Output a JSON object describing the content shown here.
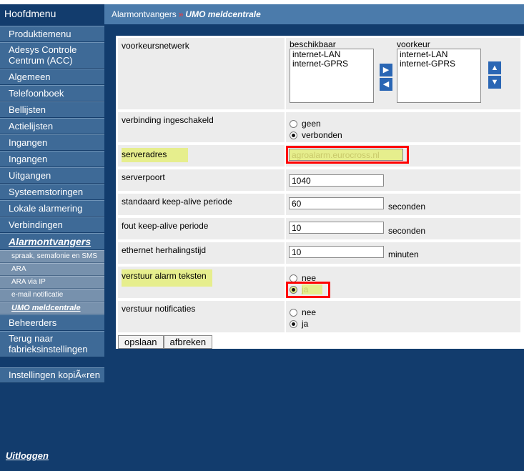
{
  "sidebar": {
    "header": "Hoofdmenu",
    "items": [
      {
        "label": "Produktiemenu"
      },
      {
        "label": "Adesys Controle Centrum (ACC)"
      },
      {
        "label": "Algemeen"
      },
      {
        "label": "Telefoonboek"
      },
      {
        "label": "Bellijsten"
      },
      {
        "label": "Actielijsten"
      },
      {
        "label": "Ingangen"
      },
      {
        "label": "Ingangen"
      },
      {
        "label": "Uitgangen"
      },
      {
        "label": "Systeemstoringen"
      },
      {
        "label": "Lokale alarmering"
      },
      {
        "label": "Verbindingen"
      },
      {
        "label": "Alarmontvangers"
      }
    ],
    "subitems": [
      {
        "label": "spraak, semafonie en SMS"
      },
      {
        "label": "ARA"
      },
      {
        "label": "ARA via IP"
      },
      {
        "label": "e-mail notificatie"
      },
      {
        "label": "UMO meldcentrale"
      }
    ],
    "bottom_items": [
      {
        "label": "Beheerders"
      },
      {
        "label": "Terug naar fabrieksinstellingen"
      },
      {
        "label": "Instellingen kopiÃ«ren"
      }
    ],
    "logout": "Uitloggen"
  },
  "breadcrumb": {
    "parent": "Alarmontvangers",
    "separator": "»",
    "current": "UMO meldcentrale"
  },
  "form": {
    "network": {
      "label": "voorkeursnetwerk",
      "available_title": "beschikbaar",
      "available": [
        "internet-LAN",
        "internet-GPRS"
      ],
      "preferred_title": "voorkeur",
      "preferred": [
        "internet-LAN",
        "internet-GPRS"
      ]
    },
    "connection": {
      "label": "verbinding ingeschakeld",
      "options": [
        "geen",
        "verbonden"
      ],
      "selected": "verbonden"
    },
    "server_address": {
      "label": "serveradres",
      "value": "agroalarm.eurocross.nl"
    },
    "server_port": {
      "label": "serverpoort",
      "value": "1040"
    },
    "keepalive": {
      "label": "standaard keep-alive periode",
      "value": "60",
      "unit": "seconden"
    },
    "fault_keepalive": {
      "label": "fout keep-alive periode",
      "value": "10",
      "unit": "seconden"
    },
    "ethernet_retry": {
      "label": "ethernet herhalingstijd",
      "value": "10",
      "unit": "minuten"
    },
    "send_alarm_texts": {
      "label": "verstuur alarm teksten",
      "options": [
        "nee",
        "ja"
      ],
      "selected": "ja"
    },
    "send_notifications": {
      "label": "verstuur notificaties",
      "options": [
        "nee",
        "ja"
      ],
      "selected": "ja"
    }
  },
  "buttons": {
    "save": "opslaan",
    "cancel": "afbreken"
  },
  "colors": {
    "sidebar_bg": "#123c6d",
    "menu_item_bg": "#3e6a97",
    "submenu_bg": "#7791ad",
    "breadcrumb_bg": "#4b7bab",
    "highlight": "#e6ee8d",
    "annotation_red": "#ff0000",
    "arrow_blue": "#2a66b4"
  },
  "icons": {
    "arrow_right": "arrow-right-icon",
    "arrow_left": "arrow-left-icon",
    "arrow_up": "arrow-up-icon",
    "arrow_down": "arrow-down-icon"
  }
}
